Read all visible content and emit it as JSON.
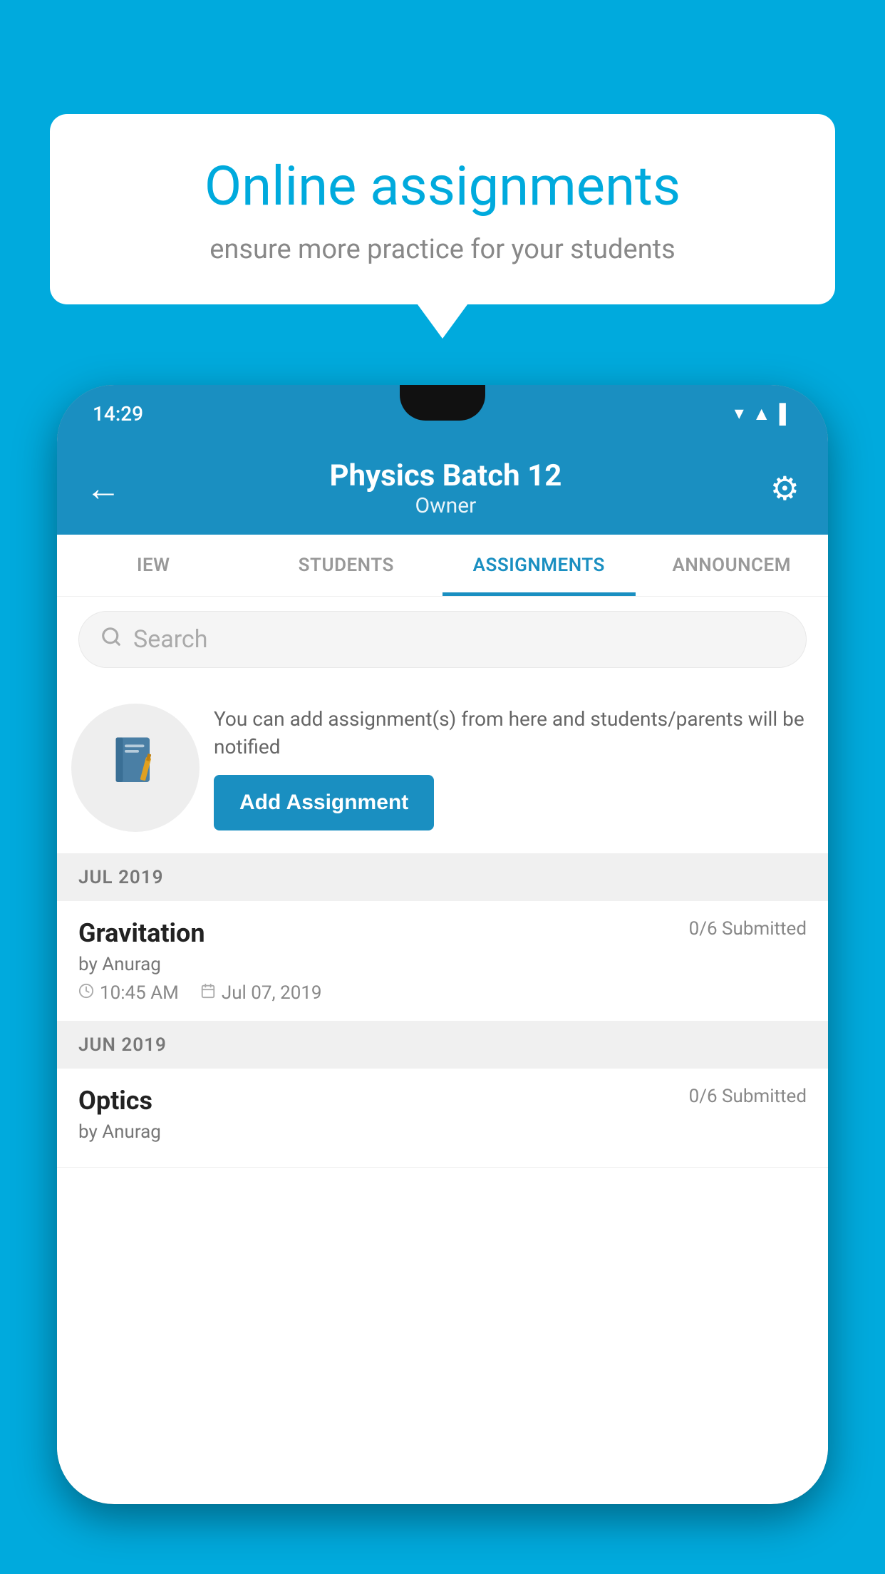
{
  "background_color": "#00AADD",
  "speech_bubble": {
    "title": "Online assignments",
    "subtitle": "ensure more practice for your students"
  },
  "phone": {
    "status_bar": {
      "time": "14:29"
    },
    "app_bar": {
      "title": "Physics Batch 12",
      "subtitle": "Owner",
      "back_label": "←",
      "settings_label": "⚙"
    },
    "tabs": [
      {
        "label": "IEW",
        "active": false
      },
      {
        "label": "STUDENTS",
        "active": false
      },
      {
        "label": "ASSIGNMENTS",
        "active": true
      },
      {
        "label": "ANNOUNCEM",
        "active": false
      }
    ],
    "search": {
      "placeholder": "Search"
    },
    "promo": {
      "text": "You can add assignment(s) from here and students/parents will be notified",
      "button_label": "Add Assignment"
    },
    "sections": [
      {
        "header": "JUL 2019",
        "items": [
          {
            "name": "Gravitation",
            "submitted": "0/6 Submitted",
            "author": "by Anurag",
            "time": "10:45 AM",
            "date": "Jul 07, 2019"
          }
        ]
      },
      {
        "header": "JUN 2019",
        "items": [
          {
            "name": "Optics",
            "submitted": "0/6 Submitted",
            "author": "by Anurag",
            "time": "",
            "date": ""
          }
        ]
      }
    ]
  }
}
